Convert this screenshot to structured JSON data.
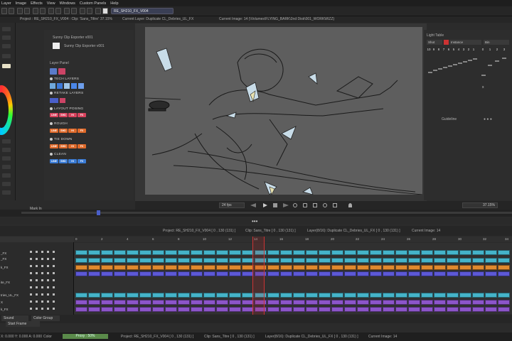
{
  "menu": [
    "Layer",
    "Image",
    "Effects",
    "View",
    "Windows",
    "Custom Panels",
    "Help"
  ],
  "toolbar": {
    "filename": "RE_SH210_FX_V004"
  },
  "infobar": {
    "project": "Project : RE_SH210_FX_V004 : Clip: 'Sans_Tiltre'",
    "zoom": "37.15%",
    "layer": "Current Layer: Duplicate CL_Debries_UL_FX",
    "image": "Current Image: 14 (\\Volumes\\FLYING_BARK\\2nd Disk\\001_WORKWIZZ)"
  },
  "clip_exporter": {
    "title": "Sunny Clip Exporter v001",
    "button": "Sunny Clip Exporter v001"
  },
  "layer_panel": {
    "title": "Layer Panel",
    "sections": [
      "TECH LAYERS",
      "RETAKE LAYERS",
      "LAYOUT POSING",
      "ROUGH",
      "TIE DOWN",
      "CLEAN"
    ],
    "chips": [
      "LINE",
      "SHD",
      "HI",
      "FX"
    ],
    "chip_colors": [
      "#d9435e",
      "#d9435e",
      "#d9435e",
      "#d9435e"
    ]
  },
  "light_table": {
    "title": "Light Table",
    "tabs": [
      "Shot",
      "Instance",
      "Bin"
    ],
    "numbers": [
      "10",
      "9",
      "8",
      "7",
      "6",
      "5",
      "4",
      "3",
      "2",
      "1",
      "0",
      "1",
      "2",
      "3"
    ]
  },
  "guideline": {
    "title": "Guideline"
  },
  "playbar": {
    "fps": "24 fps",
    "zoom": "37.15%"
  },
  "scrubber": {
    "label": "Mark In"
  },
  "timeline": {
    "header": {
      "project": "Project: RE_SH210_FX_V004 [ 0 , 130 (131) ]",
      "clip": "Clip: Sans_Titre [ 0 , 130 (131) ]",
      "layer": "Layer(8/16): Duplicate CL_Debries_UL_FX [ 0 , 130 (131) ]",
      "image": "Current Image: 14"
    },
    "layer_names": [
      "_FX",
      "_FX",
      "k_FX",
      "",
      "",
      "ite_FX",
      "",
      "",
      "tries_UL_FX",
      "X",
      "k_FX"
    ],
    "ruler": [
      "0",
      "2",
      "4",
      "6",
      "8",
      "10",
      "12",
      "14",
      "16",
      "18",
      "20",
      "22",
      "24",
      "26",
      "28",
      "30",
      "32",
      "34"
    ],
    "track_colors": [
      "#45b3c9",
      "#45b3c9",
      "#e0892e",
      "#5c58d6",
      "#45b3c9",
      "#8c55c9",
      "#8c55c9"
    ]
  },
  "bottom_controls": {
    "sound": "Sound",
    "color_group": "Color Group",
    "start_frame": "Start Frame"
  },
  "statusbar": {
    "coords": "X: 0.000 Y: 0.000 A: 0.000",
    "color": "Color",
    "proxy": "Proxy : 50%",
    "project": "Project: RE_SH210_FX_V004 [ 0 , 130 (131) ]",
    "clip": "Clip: Sans_Titre [ 0 , 130 (131) ]",
    "layer": "Layer(8/16): Duplicate CL_Debries_UL_FX [ 0 , 130 (131) ]",
    "image": "Current Image: 14"
  }
}
